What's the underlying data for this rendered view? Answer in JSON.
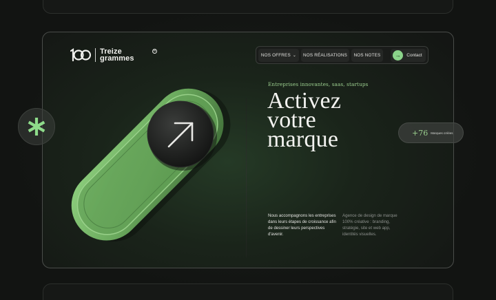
{
  "brand": {
    "name_line1": "Treize",
    "name_line2": "grammes",
    "mark": "100-logo",
    "registered": "R"
  },
  "nav": {
    "items": [
      {
        "label": "NOS OFFRES",
        "has_dropdown": true
      },
      {
        "label": "NOS RÉALISATIONS"
      },
      {
        "label": "NOS NOTES"
      }
    ],
    "contact_label": "Contact",
    "contact_icon": "arrow-right-icon"
  },
  "hero": {
    "eyebrow": "Entreprises innovantes, saas, startups",
    "headline_line1": "Activez",
    "headline_line2": "votre",
    "headline_line3": "marque",
    "paragraph_left": "Nous accompagnons les entreprises dans leurs étapes de croissance afin de dessiner leurs perspectives d'avenir.",
    "paragraph_right": "Agence de design de marque 100% créative : branding, stratégie, site et web app, identités visuelles."
  },
  "stat": {
    "value": "+76",
    "label": "Marques créées"
  },
  "colors": {
    "accent": "#8bd38a",
    "toggle_green": "#6fae62",
    "background": "#121412",
    "card_border": "#4a4d4a"
  },
  "icons": {
    "toggle_knob": "arrow-up-right-icon",
    "bubble": "asterisk-icon"
  }
}
